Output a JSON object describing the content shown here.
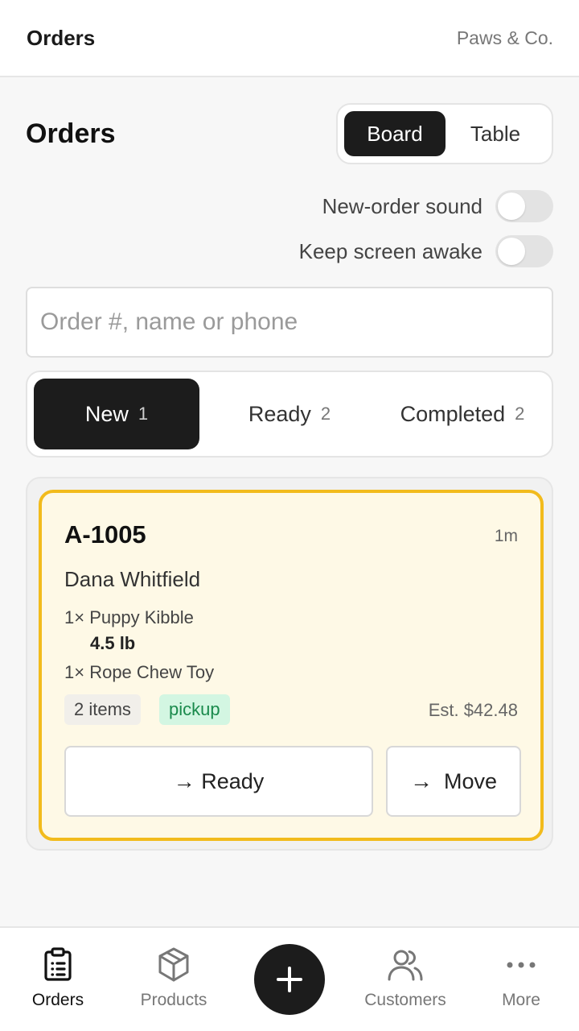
{
  "topbar": {
    "title": "Orders",
    "brand": "Paws & Co."
  },
  "page": {
    "title": "Orders"
  },
  "view_toggle": {
    "board_label": "Board",
    "table_label": "Table",
    "selected": "Board"
  },
  "settings": {
    "sound_label": "New-order sound",
    "sound_on": false,
    "awake_label": "Keep screen awake",
    "awake_on": false
  },
  "search": {
    "placeholder": "Order #, name or phone",
    "value": ""
  },
  "status_tabs": [
    {
      "label": "New",
      "count": "1",
      "active": true
    },
    {
      "label": "Ready",
      "count": "2",
      "active": false
    },
    {
      "label": "Completed",
      "count": "2",
      "active": false
    }
  ],
  "order": {
    "id": "A-1005",
    "age": "1m",
    "customer": "Dana Whitfield",
    "lines": [
      {
        "text": "1× Puppy Kibble",
        "variant": "4.5 lb"
      },
      {
        "text": "1× Rope Chew Toy",
        "variant": ""
      }
    ],
    "items_tag": "2 items",
    "fulfillment_tag": "pickup",
    "estimate": "Est. $42.48",
    "ready_button": "→ Ready",
    "move_arrow": "→",
    "move_label": "Move",
    "highlight_color": "#f2bb1c"
  },
  "bottom_nav": {
    "orders": "Orders",
    "products": "Products",
    "customers": "Customers",
    "more": "More",
    "active": "Orders"
  }
}
